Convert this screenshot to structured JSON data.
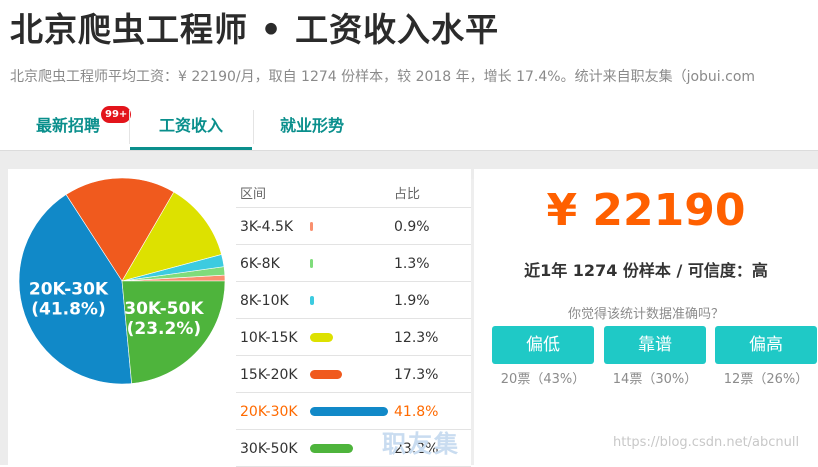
{
  "header": {
    "title": "北京爬虫工程师 • 工资收入水平",
    "subtitle": "北京爬虫工程师平均工资：¥ 22190/月，取自 1274 份样本，较 2018 年，增长 17.4%。统计来自职友集（jobui.com"
  },
  "tabs": [
    {
      "label": "最新招聘",
      "badge": "99+"
    },
    {
      "label": "工资收入"
    },
    {
      "label": "就业形势"
    }
  ],
  "table": {
    "col_range": "区间",
    "col_pct": "占比"
  },
  "chart_data": {
    "type": "pie",
    "categories": [
      "3K-4.5K",
      "6K-8K",
      "8K-10K",
      "10K-15K",
      "15K-20K",
      "20K-30K",
      "30K-50K"
    ],
    "values": [
      0.9,
      1.3,
      1.9,
      12.3,
      17.3,
      41.8,
      23.2
    ],
    "value_labels": [
      "0.9%",
      "1.3%",
      "1.9%",
      "12.3%",
      "17.3%",
      "41.8%",
      "23.2%"
    ],
    "colors": [
      "#f9906f",
      "#7fdc7b",
      "#3ccbe0",
      "#dde100",
      "#f05a1e",
      "#1189c8",
      "#4eb43c"
    ],
    "slice_labels": [
      {
        "index": 5,
        "range": "20K-30K",
        "pct": "(41.8%)"
      },
      {
        "index": 6,
        "range": "30K-50K",
        "pct": "(23.2%)"
      }
    ],
    "highlight_index": 5
  },
  "summary": {
    "salary": "¥ 22190",
    "samples": "近1年 1274 份样本 / 可信度：高",
    "question": "你觉得该统计数据准确吗？"
  },
  "votes": [
    {
      "label": "偏低",
      "count": "20票（43%）"
    },
    {
      "label": "靠谱",
      "count": "14票（30%）"
    },
    {
      "label": "偏高",
      "count": "12票（26%）"
    }
  ],
  "watermark": {
    "logo": "职友集",
    "url": "https://blog.csdn.net/abcnull"
  }
}
